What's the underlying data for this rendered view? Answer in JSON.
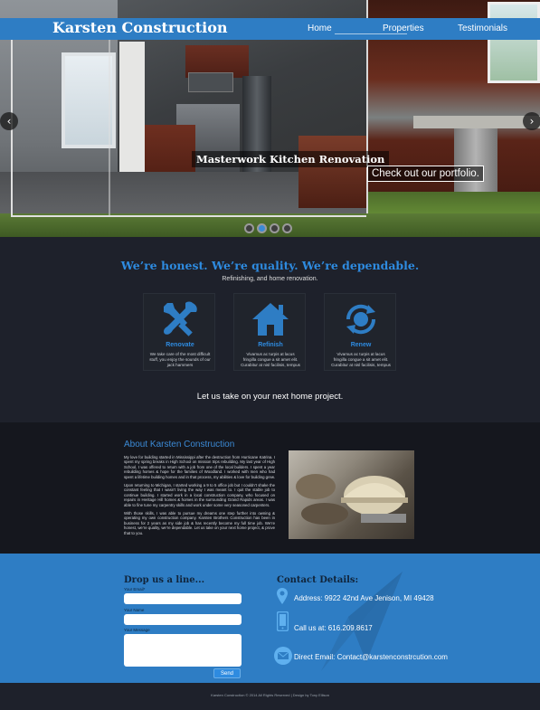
{
  "header": {
    "brand": "Karsten Construction",
    "nav": [
      "Home",
      "Properties",
      "Testimonials"
    ],
    "active_nav": "Home"
  },
  "hero": {
    "caption_title": "Masterwork Kitchen Renovation",
    "caption_link": "Check out our portfolio.",
    "prev_arrow": "‹",
    "next_arrow": "›",
    "slides": 4,
    "active_slide": 2
  },
  "services": {
    "tagline": "We’re honest. We’re quality. We’re dependable.",
    "subtagline": "Refinishing, and home renovation.",
    "cards": [
      {
        "title": "Renovate",
        "text": "We take care of the most difficult stuff, you enjoy the sounds of our jack hammers",
        "icon": "tools-icon"
      },
      {
        "title": "Refinish",
        "text": "Vivamus ac turpis at lacus fringilla congue a sit amet elit. Curabitur at nisl facilisis, tempus",
        "icon": "house-icon"
      },
      {
        "title": "Renew",
        "text": "Vivamus ac turpis at lacus fringilla congue a sit amet elit. Curabitur at nisl facilisis, tempus",
        "icon": "recycle-icon"
      }
    ],
    "cta": "Let us take on your next home project."
  },
  "about": {
    "title": "About Karsten Construction",
    "paragraphs": [
      "My love for building started in Mississippi after the destruction from Hurricane Katrina. I spent my spring breaks in High School on mission trips rebuilding. My last year of High School, I was offered to return with a job from one of the local builders. I spent a year rebuilding homes & hope for the families of Woodland. I worked with men who had spent a lifetime building homes and in that process, my abilities & love for building grew.",
      "Upon returning to Michigan, I started working a 9 to 5 office job but I couldn’t shake the constant feeling that I wasn’t living the way I was meant to. I quit the stable job to continue building. I started work in a local construction company, who focused on repairs in Heritage Hill homes & homes in the surrounding Grand Rapids areas. I was able to fine tune my carpentry skills and work under some very seasoned carpenters.",
      "With those skills, I was able to pursue my dreams one step further into owning & operating my own construction company. Karsten Brothers Construction has been in business for 2 years as my side job & has recently become my full time job. We’re honest, we’re quality, we’re dependable. Let us take on your next home project, & prove that to you."
    ]
  },
  "contact_form": {
    "title": "Drop us a line...",
    "email_label": "Your Email*",
    "name_label": "Your Name",
    "message_label": "Your Message",
    "send_label": "Send"
  },
  "contact_details": {
    "title": "Contact Details:",
    "address": "Address: 9922 42nd Ave Jenison, MI 49428",
    "phone": "Call us at: 616.209.8617",
    "email": "Direct Email: Contact@karstenconstrcution.com"
  },
  "footer": {
    "text": "Karsten Construction © 2014 All Rights Reserved | Design by Tony Ellison"
  },
  "colors": {
    "accent": "#2e7dc4",
    "accent_text": "#2e8be0",
    "dark_bg": "#1e212b"
  }
}
